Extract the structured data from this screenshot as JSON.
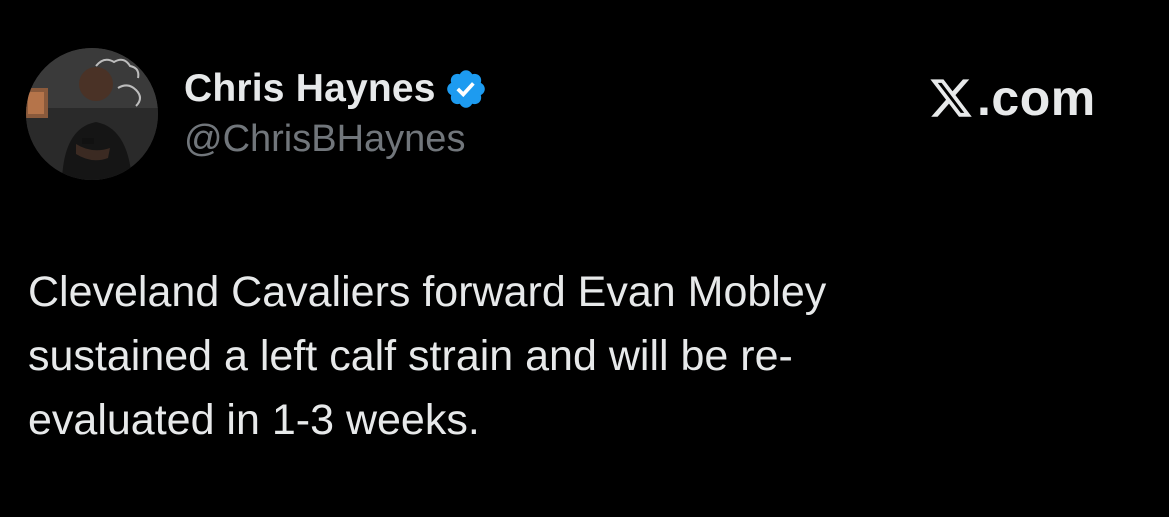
{
  "author": {
    "display_name": "Chris Haynes",
    "handle": "@ChrisBHaynes",
    "verified": true,
    "avatar": "avatar-photo"
  },
  "brand": {
    "logo_icon": "x-logo-icon",
    "domain": ".com"
  },
  "tweet": {
    "text": "Cleveland Cavaliers forward Evan Mobley\nsustained a left calf strain and will be re-\nevaluated in 1-3 weeks."
  },
  "colors": {
    "background": "#000000",
    "text_primary": "#e7e9ea",
    "text_secondary": "#71767b",
    "verified_blue": "#1d9bf0"
  }
}
